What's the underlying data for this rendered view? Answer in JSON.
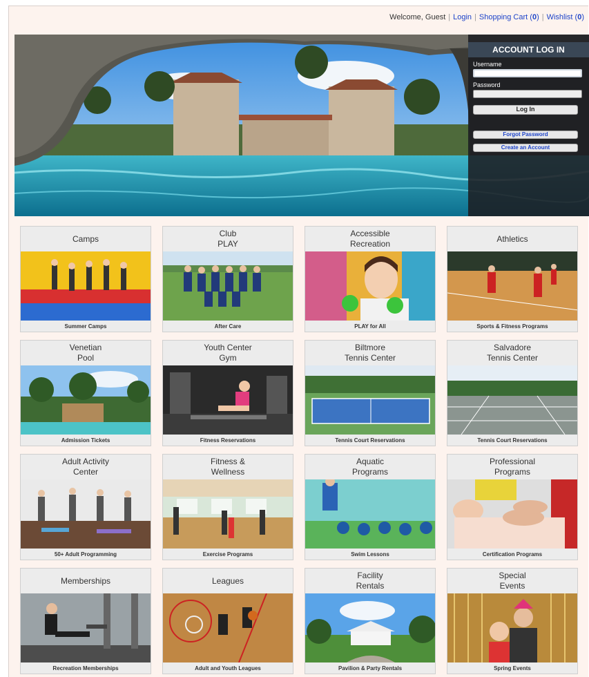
{
  "topbar": {
    "welcome": "Welcome, Guest",
    "login": "Login",
    "cart_label": "Shopping Cart (",
    "cart_count": "0",
    "cart_close": ")",
    "wishlist_label": "Wishlist (",
    "wishlist_count": "0",
    "wishlist_close": ")"
  },
  "login": {
    "title": "ACCOUNT LOG IN",
    "username_label": "Username",
    "password_label": "Password",
    "login_button": "Log In",
    "forgot": "Forgot Password",
    "create": "Create an Account"
  },
  "tiles": [
    {
      "title": "Camps",
      "caption": "Summer Camps"
    },
    {
      "title": "Club\nPLAY",
      "caption": "After Care"
    },
    {
      "title": "Accessible\nRecreation",
      "caption": "PLAY for All"
    },
    {
      "title": "Athletics",
      "caption": "Sports & Fitness Programs"
    },
    {
      "title": "Venetian\nPool",
      "caption": "Admission Tickets"
    },
    {
      "title": "Youth Center\nGym",
      "caption": "Fitness Reservations"
    },
    {
      "title": "Biltmore\nTennis Center",
      "caption": "Tennis Court Reservations"
    },
    {
      "title": "Salvadore\nTennis Center",
      "caption": "Tennis Court Reservations"
    },
    {
      "title": "Adult Activity\nCenter",
      "caption": "50+ Adult Programming"
    },
    {
      "title": "Fitness &\nWellness",
      "caption": "Exercise Programs"
    },
    {
      "title": "Aquatic\nPrograms",
      "caption": "Swim Lessons"
    },
    {
      "title": "Professional\nPrograms",
      "caption": "Certification Programs"
    },
    {
      "title": "Memberships",
      "caption": "Recreation Memberships"
    },
    {
      "title": "Leagues",
      "caption": "Adult and Youth Leagues"
    },
    {
      "title": "Facility\nRentals",
      "caption": "Pavilion & Party Rentals"
    },
    {
      "title": "Special\nEvents",
      "caption": "Spring Events"
    }
  ]
}
